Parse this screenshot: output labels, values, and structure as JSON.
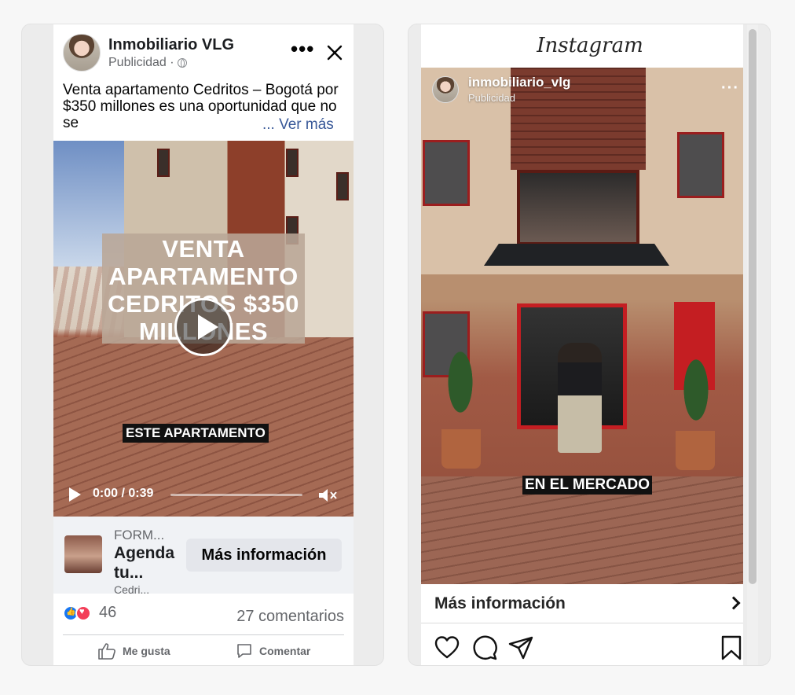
{
  "facebook": {
    "page_name": "Inmobiliario VLG",
    "sponsored": "Publicidad ·",
    "post_text": "Venta apartamento Cedritos – Bogotá por $350 millones es una oportunidad que no se",
    "see_more": "... Ver más",
    "video": {
      "title": "VENTA APARTAMENTO CEDRITOS $350 MILLONES",
      "caption": "ESTE APARTAMENTO",
      "time": "0:00 / 0:39",
      "progress": 0
    },
    "cta": {
      "label": "FORM...",
      "title": "Agenda tu...",
      "subtitle_cut": "Cedri...",
      "button": "Más información"
    },
    "reactions_count": "46",
    "comments": "27 comentarios",
    "actions": {
      "like": "Me gusta",
      "comment": "Comentar"
    }
  },
  "instagram": {
    "logo": "Instagram",
    "username": "inmobiliario_vlg",
    "sponsored": "Publicidad",
    "caption": "EN EL MERCADO",
    "cta": "Más información"
  },
  "colors": {
    "fb_link": "#385898",
    "fb_like": "#1877f2",
    "fb_love": "#f33e58",
    "building_red": "#c41e22"
  },
  "icons": [
    "more-icon",
    "close-icon",
    "globe-icon",
    "play-icon",
    "volume-mute-icon",
    "like-icon",
    "comment-icon",
    "heart-icon",
    "share-icon",
    "bookmark-icon",
    "chevron-right-icon"
  ]
}
